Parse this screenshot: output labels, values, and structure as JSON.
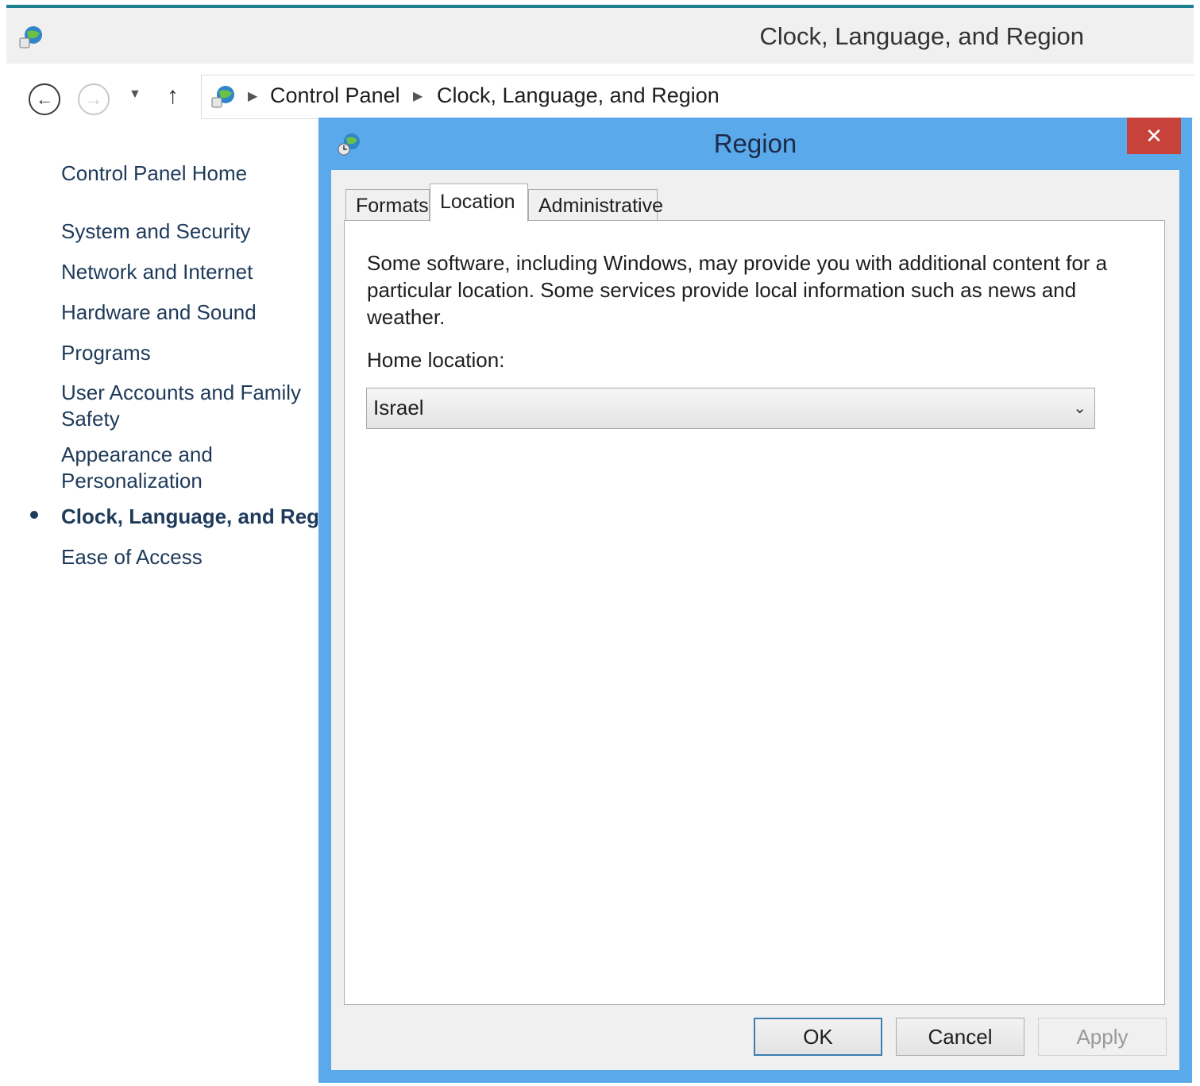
{
  "window": {
    "title": "Clock, Language, and Region"
  },
  "address": {
    "crumbs": [
      "Control Panel",
      "Clock, Language, and Region"
    ]
  },
  "sidebar": {
    "home": "Control Panel Home",
    "items": [
      "System and Security",
      "Network and Internet",
      "Hardware and Sound",
      "Programs",
      "User Accounts and Family",
      "Safety",
      "Appearance and",
      "Personalization",
      "Clock, Language, and Regio",
      "Ease of Access"
    ]
  },
  "dialog": {
    "title": "Region",
    "close": "✕",
    "tabs": [
      "Formats",
      "Location",
      "Administrative"
    ],
    "active_tab": "Location",
    "description": "Some software, including Windows, may provide you with additional content for a particular location. Some services provide local information such as news and weather.",
    "home_location_label": "Home location:",
    "home_location_value": "Israel",
    "buttons": {
      "ok": "OK",
      "cancel": "Cancel",
      "apply": "Apply"
    }
  },
  "icons": {
    "app": "control-panel-globe-icon",
    "back": "back-arrow-icon",
    "forward": "forward-arrow-icon",
    "up": "up-arrow-icon",
    "dropdown": "chevron-down-icon"
  }
}
